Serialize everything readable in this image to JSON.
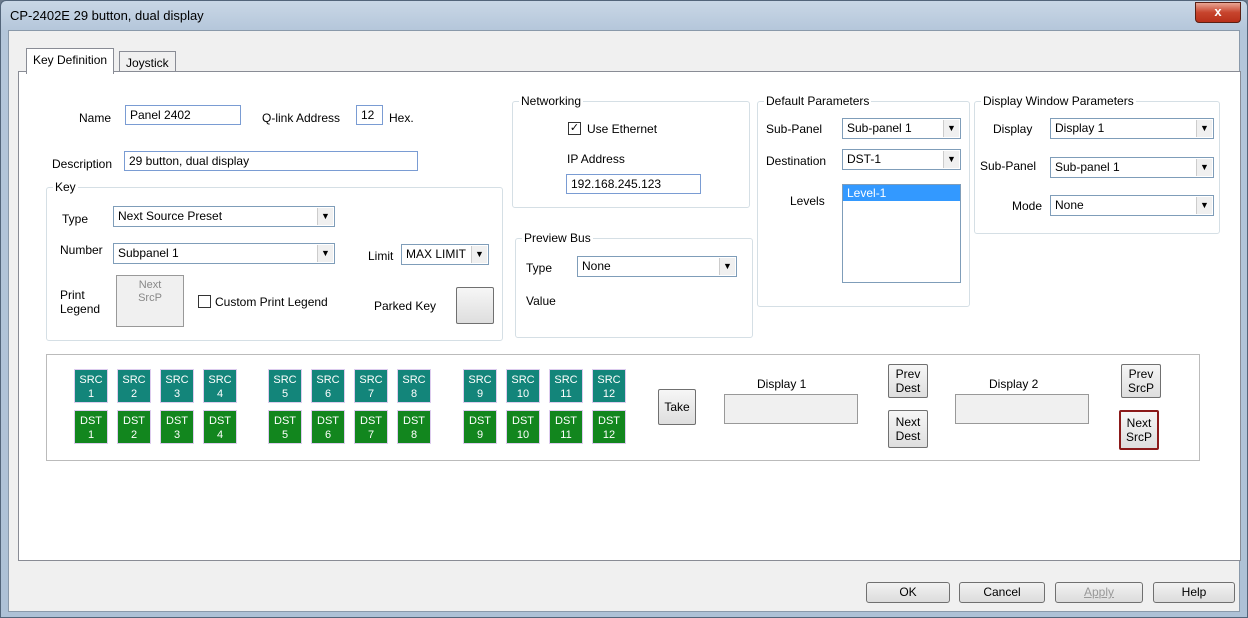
{
  "window": {
    "title": "CP-2402E 29 button, dual display",
    "close_glyph": "x"
  },
  "tabs": [
    {
      "label": "Key Definition"
    },
    {
      "label": "Joystick"
    }
  ],
  "panel": {
    "name_label": "Name",
    "name_value": "Panel 2402",
    "qlink_label": "Q-link Address",
    "qlink_value": "12",
    "hex_label": "Hex.",
    "description_label": "Description",
    "description_value": "29 button, dual display"
  },
  "key": {
    "group_label": "Key",
    "type_label": "Type",
    "type_value": "Next Source Preset",
    "number_label": "Number",
    "number_value": "Subpanel 1",
    "limit_label": "Limit",
    "limit_value": "MAX LIMIT",
    "print_legend_label_1": "Print",
    "print_legend_label_2": "Legend",
    "legend_line_1": "Next",
    "legend_line_2": "SrcP",
    "custom_print_legend_label": "Custom Print Legend",
    "parked_key_label": "Parked Key"
  },
  "networking": {
    "group_label": "Networking",
    "use_ethernet_label": "Use Ethernet",
    "ip_address_label": "IP Address",
    "ip_address_value": "192.168.245.123"
  },
  "preview_bus": {
    "group_label": "Preview Bus",
    "type_label": "Type",
    "type_value": "None",
    "value_label": "Value"
  },
  "default_parameters": {
    "group_label": "Default Parameters",
    "subpanel_label": "Sub-Panel",
    "subpanel_value": "Sub-panel 1",
    "destination_label": "Destination",
    "destination_value": "DST-1",
    "levels_label": "Levels",
    "levels_selected": "Level-1"
  },
  "display_window": {
    "group_label": "Display Window Parameters",
    "display_label": "Display",
    "display_value": "Display 1",
    "subpanel_label": "Sub-Panel",
    "subpanel_value": "Sub-panel 1",
    "mode_label": "Mode",
    "mode_value": "None"
  },
  "layout_panel": {
    "src_groups": [
      [
        {
          "a": "SRC",
          "b": "1"
        },
        {
          "a": "SRC",
          "b": "2"
        },
        {
          "a": "SRC",
          "b": "3"
        },
        {
          "a": "SRC",
          "b": "4"
        }
      ],
      [
        {
          "a": "SRC",
          "b": "5"
        },
        {
          "a": "SRC",
          "b": "6"
        },
        {
          "a": "SRC",
          "b": "7"
        },
        {
          "a": "SRC",
          "b": "8"
        }
      ],
      [
        {
          "a": "SRC",
          "b": "9"
        },
        {
          "a": "SRC",
          "b": "10"
        },
        {
          "a": "SRC",
          "b": "11"
        },
        {
          "a": "SRC",
          "b": "12"
        }
      ]
    ],
    "dst_groups": [
      [
        {
          "a": "DST",
          "b": "1"
        },
        {
          "a": "DST",
          "b": "2"
        },
        {
          "a": "DST",
          "b": "3"
        },
        {
          "a": "DST",
          "b": "4"
        }
      ],
      [
        {
          "a": "DST",
          "b": "5"
        },
        {
          "a": "DST",
          "b": "6"
        },
        {
          "a": "DST",
          "b": "7"
        },
        {
          "a": "DST",
          "b": "8"
        }
      ],
      [
        {
          "a": "DST",
          "b": "9"
        },
        {
          "a": "DST",
          "b": "10"
        },
        {
          "a": "DST",
          "b": "11"
        },
        {
          "a": "DST",
          "b": "12"
        }
      ]
    ],
    "take_label": "Take",
    "display1_label": "Display 1",
    "display2_label": "Display 2",
    "prev_dest": [
      "Prev",
      "Dest"
    ],
    "next_dest": [
      "Next",
      "Dest"
    ],
    "prev_srcp": [
      "Prev",
      "SrcP"
    ],
    "next_srcp": [
      "Next",
      "SrcP"
    ]
  },
  "buttons": {
    "ok": "OK",
    "cancel": "Cancel",
    "apply": "Apply",
    "help": "Help"
  }
}
